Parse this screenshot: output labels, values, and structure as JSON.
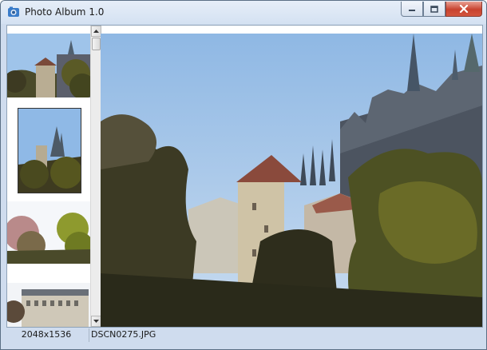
{
  "window": {
    "title": "Photo Album 1.0"
  },
  "icons": {
    "app": "photo-album-icon",
    "minimize": "minimize-icon",
    "maximize": "maximize-icon",
    "close": "close-icon",
    "scroll_up": "arrow-up-icon",
    "scroll_down": "arrow-down-icon"
  },
  "colors": {
    "sky": "#9cc2e9",
    "close_button": "#c8432f",
    "frame": "#cfdcee"
  },
  "thumbnails": [
    {
      "name": "thumbnail-castle-1"
    },
    {
      "name": "thumbnail-castle-2"
    },
    {
      "name": "thumbnail-tree"
    },
    {
      "name": "thumbnail-building"
    }
  ],
  "status": {
    "resolution": "2048x1536",
    "filename": "DSCN0275.JPG"
  }
}
